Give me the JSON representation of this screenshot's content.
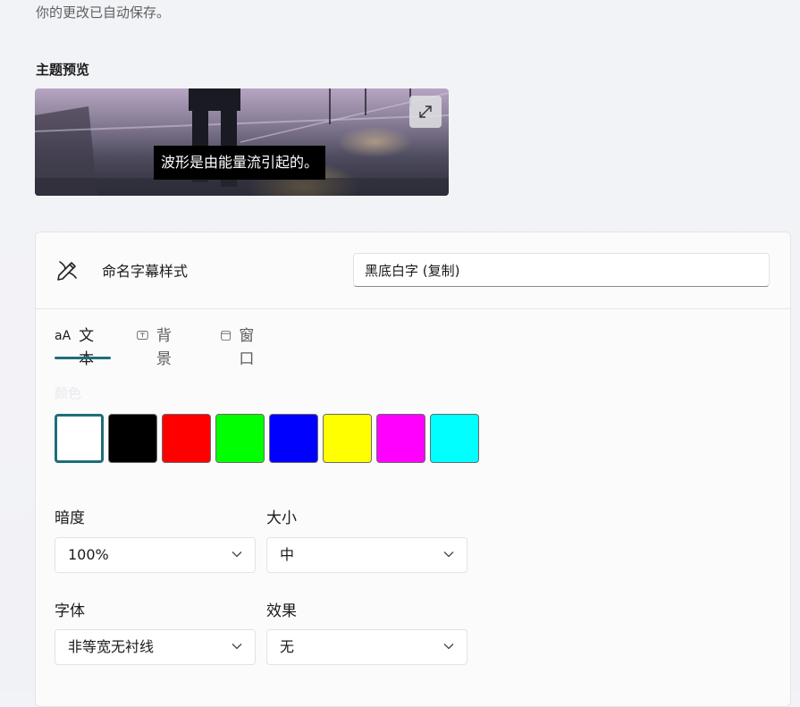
{
  "autosave_note": "你的更改已自动保存。",
  "preview": {
    "heading": "主题预览",
    "caption_sample": "波形是由能量流引起的。",
    "expand_icon": "expand-icon"
  },
  "style_name": {
    "label": "命名字幕样式",
    "value": "黑底白字 (复制)",
    "icon": "brush-pen-icon"
  },
  "tabs": [
    {
      "label": "文本",
      "glyph": "aA",
      "active": true
    },
    {
      "label": "背景",
      "icon": "text-box-icon",
      "active": false
    },
    {
      "label": "窗口",
      "icon": "window-icon",
      "active": false
    }
  ],
  "color": {
    "label": "颜色",
    "swatches": [
      "#ffffff",
      "#000000",
      "#ff0000",
      "#00ff00",
      "#0000ff",
      "#ffff00",
      "#ff00ff",
      "#00ffff"
    ],
    "selected_index": 0
  },
  "fields": {
    "opacity": {
      "label": "暗度",
      "value": "100%"
    },
    "size": {
      "label": "大小",
      "value": "中"
    },
    "font": {
      "label": "字体",
      "value": "非等宽无衬线"
    },
    "effect": {
      "label": "效果",
      "value": "无"
    }
  },
  "accent_color": "#1f6e7a"
}
